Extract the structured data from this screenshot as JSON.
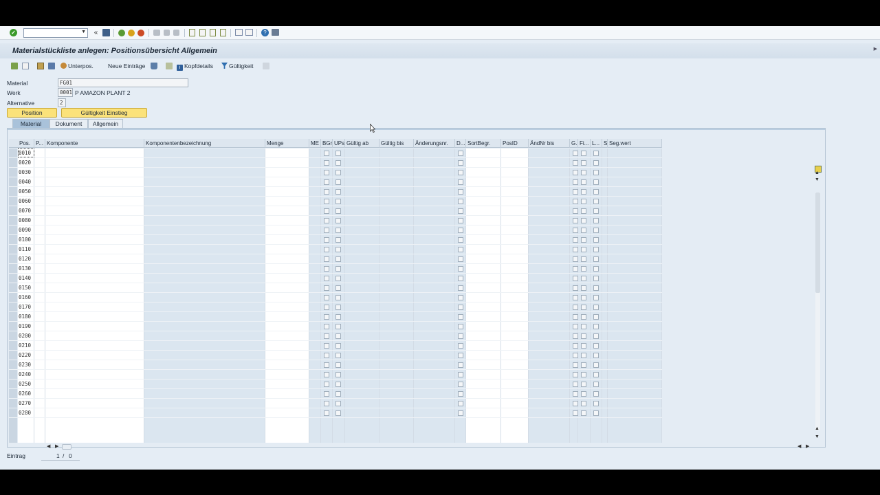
{
  "colors": {
    "accent_yellow": "#fbe27a",
    "title_bg": "#d3dfeb",
    "active_tab": "#a9c2da",
    "grid_blue": "#dbe6f0"
  },
  "system_toolbar": {
    "icons": [
      "ok-icon",
      "command-field",
      "back-icon",
      "save-icon",
      "back-green-icon",
      "exit-yellow-icon",
      "cancel-red-icon",
      "print-icon",
      "find-icon",
      "find-next-icon",
      "first-page-icon",
      "prev-page-icon",
      "next-page-icon",
      "last-page-icon",
      "new-session-icon",
      "shortcut-icon",
      "help-icon",
      "customize-icon"
    ]
  },
  "title": "Materialstückliste anlegen: Positionsübersicht Allgemein",
  "app_toolbar": {
    "subitems": "Unterpos.",
    "new_entries": "Neue Einträge",
    "header_details": "Kopfdetails",
    "validity": "Gültigkeit"
  },
  "header": {
    "material_label": "Material",
    "material_value": "FG01",
    "plant_label": "Werk",
    "plant_value": "0001",
    "plant_text": "P AMAZON PLANT 2",
    "alternative_label": "Alternative",
    "alternative_value": "2",
    "btn_position": "Position",
    "btn_validity": "Gültigkeit Einstieg"
  },
  "tabs": [
    "Material",
    "Dokument",
    "Allgemein"
  ],
  "columns": [
    "Pos.",
    "P...",
    "Komponente",
    "Komponentenbezeichnung",
    "Menge",
    "ME",
    "BGr",
    "UPs",
    "Gültig ab",
    "Gültig bis",
    "Änderungsnr.",
    "D...",
    "SortBegr.",
    "PosID",
    "ÄndNr bis",
    "G..",
    "Fi...",
    "L...",
    "S",
    "Seg.wert"
  ],
  "rows": [
    "0010",
    "0020",
    "0030",
    "0040",
    "0050",
    "0060",
    "0070",
    "0080",
    "0090",
    "0100",
    "0110",
    "0120",
    "0130",
    "0140",
    "0150",
    "0160",
    "0170",
    "0180",
    "0190",
    "0200",
    "0210",
    "0220",
    "0230",
    "0240",
    "0250",
    "0260",
    "0270",
    "0280"
  ],
  "footer": {
    "label": "Eintrag",
    "current": "1",
    "separator": "/",
    "total": "0"
  }
}
